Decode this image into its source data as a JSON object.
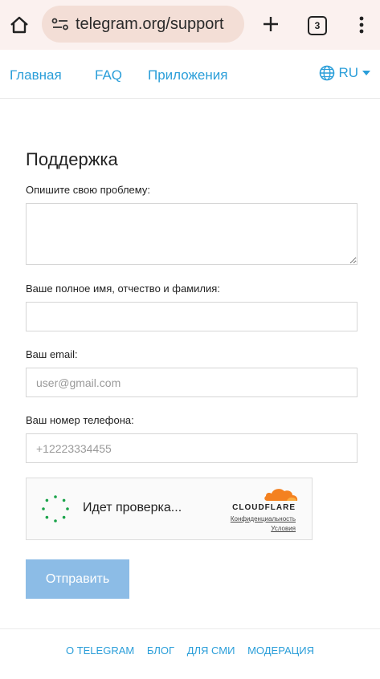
{
  "browser": {
    "url": "telegram.org/support",
    "tab_count": "3"
  },
  "nav": {
    "home": "Главная",
    "faq": "FAQ",
    "apps": "Приложения",
    "lang": "RU"
  },
  "form": {
    "title": "Поддержка",
    "problem_label": "Опишите свою проблему:",
    "name_label": "Ваше полное имя, отчество и фамилия:",
    "email_label": "Ваш email:",
    "email_placeholder": "user@gmail.com",
    "phone_label": "Ваш номер телефона:",
    "phone_placeholder": "+12223334455",
    "submit": "Отправить"
  },
  "captcha": {
    "status": "Идет проверка...",
    "brand": "CLOUDFLARE",
    "privacy": "Конфиденциальность",
    "terms": "Условия"
  },
  "footer": {
    "links": [
      "О TELEGRAM",
      "БЛОГ",
      "ДЛЯ СМИ",
      "МОДЕРАЦИЯ"
    ]
  },
  "colors": {
    "accent": "#2a9ed9",
    "submit_bg": "#8cbce6",
    "chrome_bg": "#fbf1ef",
    "cloudflare_orange": "#f48120"
  }
}
